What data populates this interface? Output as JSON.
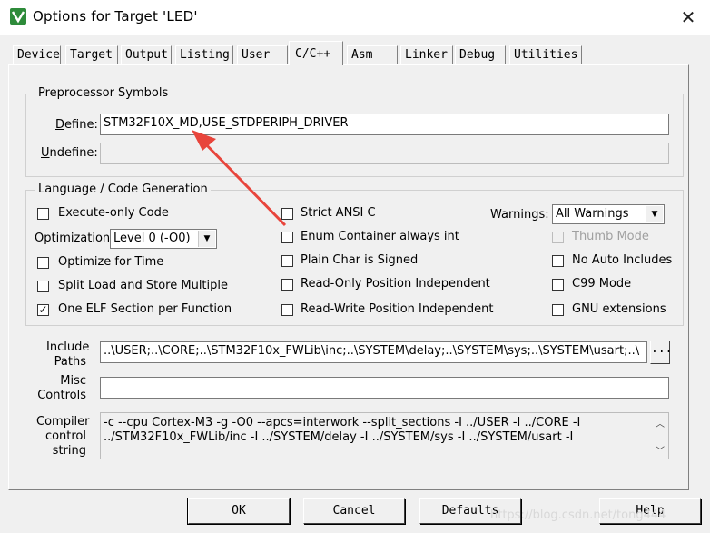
{
  "window": {
    "title": "Options for Target 'LED'",
    "close_glyph": "✕",
    "app_icon": "keil-uvision-icon"
  },
  "tabs": [
    {
      "label": "Device",
      "active": false
    },
    {
      "label": "Target",
      "active": false
    },
    {
      "label": "Output",
      "active": false
    },
    {
      "label": "Listing",
      "active": false
    },
    {
      "label": "User",
      "active": false
    },
    {
      "label": "C/C++",
      "active": true
    },
    {
      "label": "Asm",
      "active": false
    },
    {
      "label": "Linker",
      "active": false
    },
    {
      "label": "Debug",
      "active": false
    },
    {
      "label": "Utilities",
      "active": false
    }
  ],
  "preprocessor": {
    "title": "Preprocessor Symbols",
    "define_label": "Define:",
    "define_value": "STM32F10X_MD,USE_STDPERIPH_DRIVER",
    "undefine_label": "Undefine:",
    "undefine_value": ""
  },
  "language": {
    "title": "Language / Code Generation",
    "execute_only": {
      "label": "Execute-only Code",
      "checked": false
    },
    "optimization_label": "Optimization:",
    "optimization_value": "Level 0 (-O0)",
    "optimize_time": {
      "label": "Optimize for Time",
      "checked": false
    },
    "split_load": {
      "label": "Split Load and Store Multiple",
      "checked": false
    },
    "one_elf": {
      "label": "One ELF Section per Function",
      "checked": true
    },
    "strict_ansi": {
      "label": "Strict ANSI C",
      "checked": false
    },
    "enum_container": {
      "label": "Enum Container always int",
      "checked": false
    },
    "plain_char": {
      "label": "Plain Char is Signed",
      "checked": false
    },
    "ro_pi": {
      "label": "Read-Only Position Independent",
      "checked": false
    },
    "rw_pi": {
      "label": "Read-Write Position Independent",
      "checked": false
    },
    "warnings_label": "Warnings:",
    "warnings_value": "All Warnings",
    "thumb_mode": {
      "label": "Thumb Mode",
      "checked": false,
      "disabled": true
    },
    "no_auto_includes": {
      "label": "No Auto Includes",
      "checked": false
    },
    "c99_mode": {
      "label": "C99 Mode",
      "checked": false
    },
    "gnu_extensions": {
      "label": "GNU extensions",
      "checked": false
    }
  },
  "include": {
    "label_line1": "Include",
    "label_line2": "Paths",
    "value": "..\\USER;..\\CORE;..\\STM32F10x_FWLib\\inc;..\\SYSTEM\\delay;..\\SYSTEM\\sys;..\\SYSTEM\\usart;..\\",
    "browse_label": "..."
  },
  "misc": {
    "label_line1": "Misc",
    "label_line2": "Controls",
    "value": ""
  },
  "compiler": {
    "label_line1": "Compiler",
    "label_line2": "control",
    "label_line3": "string",
    "line1": "-c --cpu Cortex-M3 -g -O0 --apcs=interwork --split_sections -I ../USER -I ../CORE -I",
    "line2": "../STM32F10x_FWLib/inc -I ../SYSTEM/delay -I ../SYSTEM/sys -I ../SYSTEM/usart -I"
  },
  "buttons": {
    "ok": "OK",
    "cancel": "Cancel",
    "defaults": "Defaults",
    "help": "Help"
  },
  "watermark": "https://blog.csdn.net/tong444",
  "annotation_color": "#e8453c"
}
